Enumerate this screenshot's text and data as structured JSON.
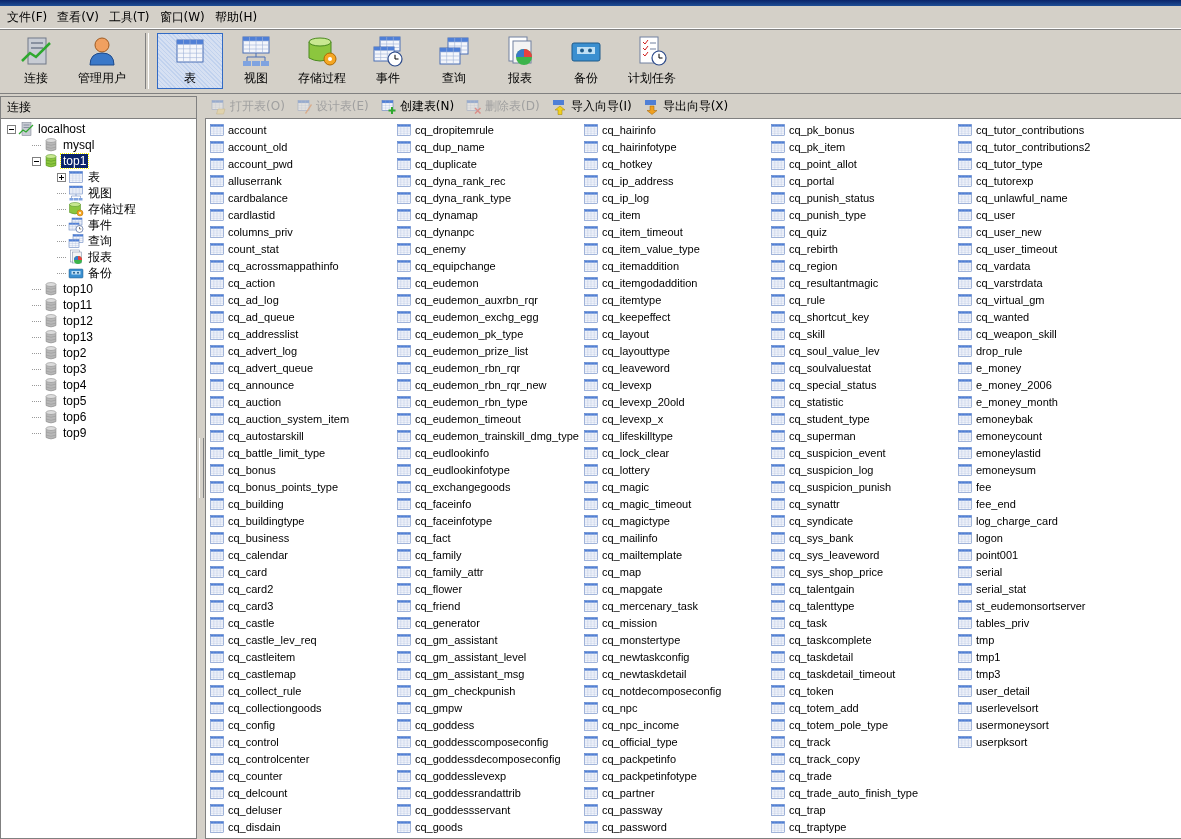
{
  "menu": [
    {
      "label": "文件(F)"
    },
    {
      "label": "查看(V)"
    },
    {
      "label": "工具(T)"
    },
    {
      "label": "窗口(W)"
    },
    {
      "label": "帮助(H)"
    }
  ],
  "toolbar": [
    {
      "label": "连接",
      "kind": "connect",
      "selected": false
    },
    {
      "label": "管理用户",
      "kind": "user",
      "selected": false
    },
    {
      "label": "表",
      "kind": "table",
      "selected": true
    },
    {
      "label": "视图",
      "kind": "view",
      "selected": false
    },
    {
      "label": "存储过程",
      "kind": "procedure",
      "selected": false
    },
    {
      "label": "事件",
      "kind": "event",
      "selected": false
    },
    {
      "label": "查询",
      "kind": "query",
      "selected": false
    },
    {
      "label": "报表",
      "kind": "report",
      "selected": false
    },
    {
      "label": "备份",
      "kind": "backup",
      "selected": false
    },
    {
      "label": "计划任务",
      "kind": "schedule",
      "selected": false
    }
  ],
  "sidebar": {
    "header": "连接"
  },
  "tree": [
    {
      "label": "localhost",
      "kind": "connect",
      "expanded": true,
      "selected": false,
      "children": [
        {
          "label": "mysql",
          "kind": "database",
          "open": false,
          "selected": false
        },
        {
          "label": "top1",
          "kind": "database",
          "open": true,
          "expanded": true,
          "selected": true,
          "children": [
            {
              "label": "表",
              "kind": "table",
              "expanded": false,
              "selected": false
            },
            {
              "label": "视图",
              "kind": "view",
              "selected": false
            },
            {
              "label": "存储过程",
              "kind": "procedure",
              "selected": false
            },
            {
              "label": "事件",
              "kind": "event",
              "selected": false
            },
            {
              "label": "查询",
              "kind": "query",
              "selected": false
            },
            {
              "label": "报表",
              "kind": "report",
              "selected": false
            },
            {
              "label": "备份",
              "kind": "backup",
              "selected": false
            }
          ]
        },
        {
          "label": "top10",
          "kind": "database",
          "open": false,
          "selected": false
        },
        {
          "label": "top11",
          "kind": "database",
          "open": false,
          "selected": false
        },
        {
          "label": "top12",
          "kind": "database",
          "open": false,
          "selected": false
        },
        {
          "label": "top13",
          "kind": "database",
          "open": false,
          "selected": false
        },
        {
          "label": "top2",
          "kind": "database",
          "open": false,
          "selected": false
        },
        {
          "label": "top3",
          "kind": "database",
          "open": false,
          "selected": false
        },
        {
          "label": "top4",
          "kind": "database",
          "open": false,
          "selected": false
        },
        {
          "label": "top5",
          "kind": "database",
          "open": false,
          "selected": false
        },
        {
          "label": "top6",
          "kind": "database",
          "open": false,
          "selected": false
        },
        {
          "label": "top9",
          "kind": "database",
          "open": false,
          "selected": false
        }
      ]
    }
  ],
  "actions": [
    {
      "label": "打开表(O)",
      "kind": "open",
      "disabled": true
    },
    {
      "label": "设计表(E)",
      "kind": "design",
      "disabled": true
    },
    {
      "label": "创建表(N)",
      "kind": "create",
      "disabled": false
    },
    {
      "label": "删除表(D)",
      "kind": "delete",
      "disabled": true
    },
    {
      "label": "导入向导(I)",
      "kind": "import",
      "disabled": false
    },
    {
      "label": "导出向导(X)",
      "kind": "export",
      "disabled": false
    }
  ],
  "tables": [
    "account",
    "account_old",
    "account_pwd",
    "alluserrank",
    "cardbalance",
    "cardlastid",
    "columns_priv",
    "count_stat",
    "cq_acrossmappathinfo",
    "cq_action",
    "cq_ad_log",
    "cq_ad_queue",
    "cq_addresslist",
    "cq_advert_log",
    "cq_advert_queue",
    "cq_announce",
    "cq_auction",
    "cq_auction_system_item",
    "cq_autostarskill",
    "cq_battle_limit_type",
    "cq_bonus",
    "cq_bonus_points_type",
    "cq_building",
    "cq_buildingtype",
    "cq_business",
    "cq_calendar",
    "cq_card",
    "cq_card2",
    "cq_card3",
    "cq_castle",
    "cq_castle_lev_req",
    "cq_castleitem",
    "cq_castlemap",
    "cq_collect_rule",
    "cq_collectiongoods",
    "cq_config",
    "cq_control",
    "cq_controlcenter",
    "cq_counter",
    "cq_delcount",
    "cq_deluser",
    "cq_disdain",
    "cq_dropitemrule",
    "cq_dup_name",
    "cq_duplicate",
    "cq_dyna_rank_rec",
    "cq_dyna_rank_type",
    "cq_dynamap",
    "cq_dynanpc",
    "cq_enemy",
    "cq_equipchange",
    "cq_eudemon",
    "cq_eudemon_auxrbn_rqr",
    "cq_eudemon_exchg_egg",
    "cq_eudemon_pk_type",
    "cq_eudemon_prize_list",
    "cq_eudemon_rbn_rqr",
    "cq_eudemon_rbn_rqr_new",
    "cq_eudemon_rbn_type",
    "cq_eudemon_timeout",
    "cq_eudemon_trainskill_dmg_type",
    "cq_eudlookinfo",
    "cq_eudlookinfotype",
    "cq_exchangegoods",
    "cq_faceinfo",
    "cq_faceinfotype",
    "cq_fact",
    "cq_family",
    "cq_family_attr",
    "cq_flower",
    "cq_friend",
    "cq_generator",
    "cq_gm_assistant",
    "cq_gm_assistant_level",
    "cq_gm_assistant_msg",
    "cq_gm_checkpunish",
    "cq_gmpw",
    "cq_goddess",
    "cq_goddesscomposeconfig",
    "cq_goddessdecomposeconfig",
    "cq_goddesslevexp",
    "cq_goddessrandattrib",
    "cq_goddessservant",
    "cq_goods",
    "cq_hairinfo",
    "cq_hairinfotype",
    "cq_hotkey",
    "cq_ip_address",
    "cq_ip_log",
    "cq_item",
    "cq_item_timeout",
    "cq_item_value_type",
    "cq_itemaddition",
    "cq_itemgodaddition",
    "cq_itemtype",
    "cq_keepeffect",
    "cq_layout",
    "cq_layouttype",
    "cq_leaveword",
    "cq_levexp",
    "cq_levexp_20old",
    "cq_levexp_x",
    "cq_lifeskilltype",
    "cq_lock_clear",
    "cq_lottery",
    "cq_magic",
    "cq_magic_timeout",
    "cq_magictype",
    "cq_mailinfo",
    "cq_mailtemplate",
    "cq_map",
    "cq_mapgate",
    "cq_mercenary_task",
    "cq_mission",
    "cq_monstertype",
    "cq_newtaskconfig",
    "cq_newtaskdetail",
    "cq_notdecomposeconfig",
    "cq_npc",
    "cq_npc_income",
    "cq_official_type",
    "cq_packpetinfo",
    "cq_packpetinfotype",
    "cq_partner",
    "cq_passway",
    "cq_password",
    "cq_pk_bonus",
    "cq_pk_item",
    "cq_point_allot",
    "cq_portal",
    "cq_punish_status",
    "cq_punish_type",
    "cq_quiz",
    "cq_rebirth",
    "cq_region",
    "cq_resultantmagic",
    "cq_rule",
    "cq_shortcut_key",
    "cq_skill",
    "cq_soul_value_lev",
    "cq_soulvaluestat",
    "cq_special_status",
    "cq_statistic",
    "cq_student_type",
    "cq_superman",
    "cq_suspicion_event",
    "cq_suspicion_log",
    "cq_suspicion_punish",
    "cq_synattr",
    "cq_syndicate",
    "cq_sys_bank",
    "cq_sys_leaveword",
    "cq_sys_shop_price",
    "cq_talentgain",
    "cq_talenttype",
    "cq_task",
    "cq_taskcomplete",
    "cq_taskdetail",
    "cq_taskdetail_timeout",
    "cq_token",
    "cq_totem_add",
    "cq_totem_pole_type",
    "cq_track",
    "cq_track_copy",
    "cq_trade",
    "cq_trade_auto_finish_type",
    "cq_trap",
    "cq_traptype",
    "cq_tutor_contributions",
    "cq_tutor_contributions2",
    "cq_tutor_type",
    "cq_tutorexp",
    "cq_unlawful_name",
    "cq_user",
    "cq_user_new",
    "cq_user_timeout",
    "cq_vardata",
    "cq_varstrdata",
    "cq_virtual_gm",
    "cq_wanted",
    "cq_weapon_skill",
    "drop_rule",
    "e_money",
    "e_money_2006",
    "e_money_month",
    "emoneybak",
    "emoneycount",
    "emoneylastid",
    "emoneysum",
    "fee",
    "fee_end",
    "log_charge_card",
    "logon",
    "point001",
    "serial",
    "serial_stat",
    "st_eudemonsortserver",
    "tables_priv",
    "tmp",
    "tmp1",
    "tmp3",
    "user_detail",
    "userlevelsort",
    "usermoneysort",
    "userpksort"
  ]
}
